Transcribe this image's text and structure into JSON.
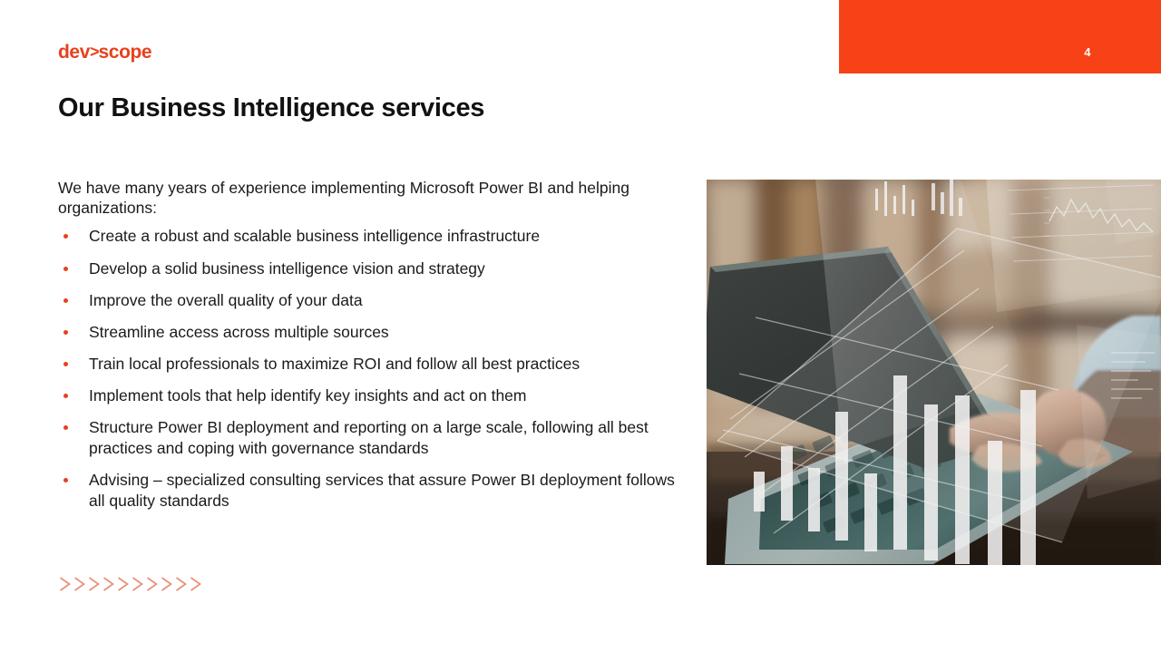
{
  "slide": {
    "logo_text_left": "dev",
    "logo_text_gt": ">",
    "logo_text_right": "scope",
    "number": "4",
    "title": "Our Business Intelligence services",
    "intro": "We have many years of experience implementing Microsoft Power BI and helping organizations:",
    "bullets": [
      "Create a robust and scalable business intelligence infrastructure",
      "Develop a solid business intelligence vision and strategy",
      "Improve the overall quality of your data",
      "Streamline access across multiple sources",
      "Train local professionals to maximize ROI and follow all best practices",
      "Implement tools that help identify key insights and act on them",
      "Structure Power BI deployment and reporting on a large scale, following all best practices and coping with governance standards",
      "Advising – specialized consulting services that assure Power BI deployment follows all quality standards"
    ],
    "chevron_count": 10,
    "colors": {
      "accent_orange": "#f64216",
      "logo_orange": "#e8401c",
      "bullet_orange": "#e8401c",
      "chevron_orange": "#e79077",
      "title_black": "#111111",
      "body_black": "#1a1a1a",
      "banner_number_white": "#ffffff"
    },
    "photo": {
      "alt": "person typing on a laptop with a translucent holographic bar chart overlay"
    }
  }
}
